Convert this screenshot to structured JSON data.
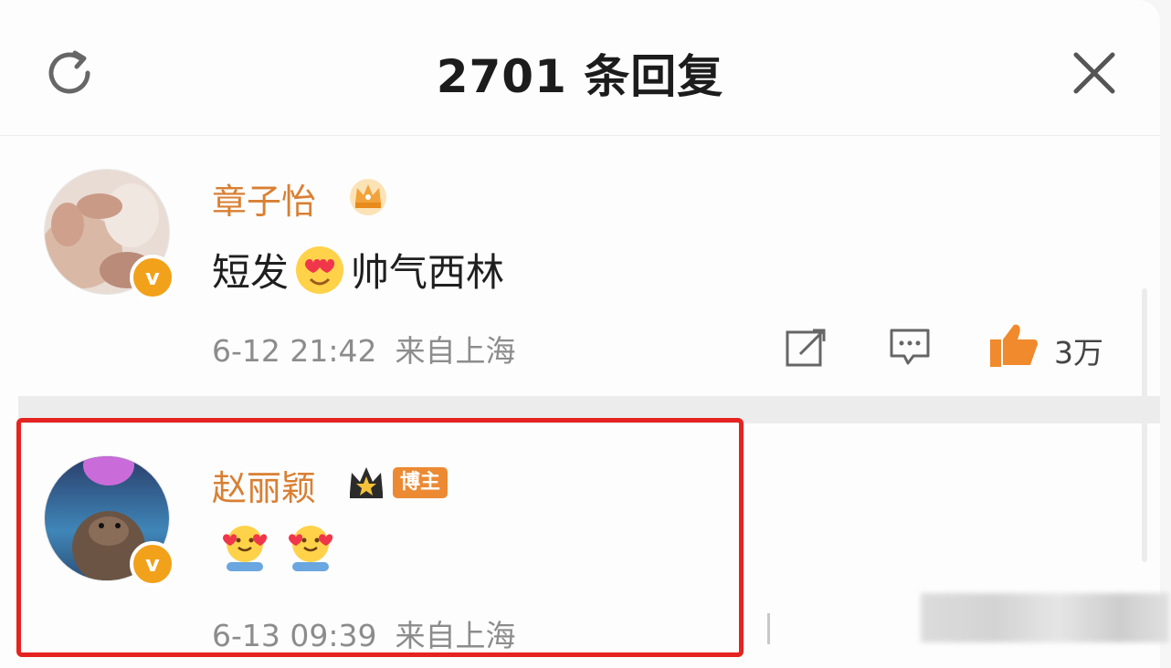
{
  "header": {
    "title": "2701 条回复",
    "refresh_icon": "refresh-icon",
    "close_icon": "close-icon"
  },
  "comments": [
    {
      "username": "章子怡",
      "badge_icon": "crown-icon",
      "verified_icon": "verified-v-icon",
      "verified_mark": "v",
      "text_before": "短发",
      "emoji": "heart-eyes-emoji",
      "text_after": "帅气西林",
      "date": "6-12 21:42",
      "location": "来自上海",
      "actions": {
        "repost_icon": "repost-icon",
        "reply_icon": "comment-icon",
        "like_icon": "thumbs-up-icon",
        "like_count": "3万"
      }
    },
    {
      "username": "赵丽颖",
      "badge_icon": "crown-icon",
      "tag": "博主",
      "verified_icon": "verified-v-icon",
      "verified_mark": "v",
      "emojis": [
        "hug-emoji",
        "hug-emoji"
      ],
      "date": "6-13 09:39",
      "location": "来自上海"
    }
  ],
  "colors": {
    "username": "#d97f33",
    "highlight": "#e52320",
    "like": "#f08a2c",
    "verified": "#f2a11a"
  }
}
